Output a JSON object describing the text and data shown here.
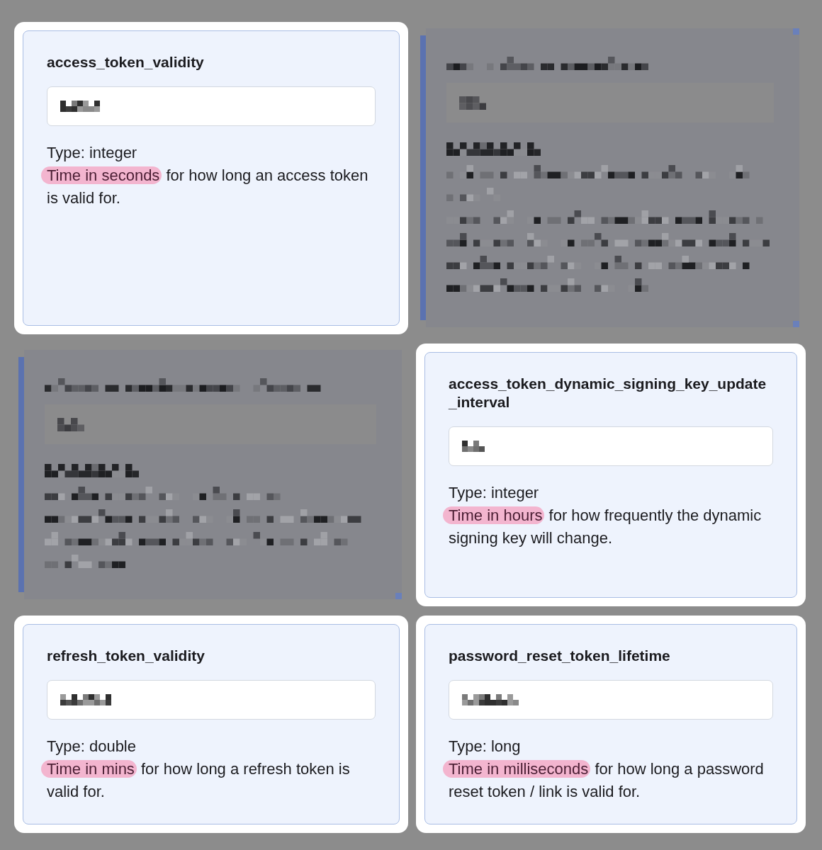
{
  "cards": [
    {
      "kind": "highlighted",
      "title": "access_token_validity",
      "field": {
        "pixelated": true
      },
      "type_line": "Type: integer",
      "description": [
        {
          "text": "Time in seconds",
          "highlighted": true
        },
        {
          "text": "for how long an access token is valid for.",
          "highlighted": false
        }
      ]
    },
    {
      "kind": "obscured"
    },
    {
      "kind": "obscured"
    },
    {
      "kind": "highlighted",
      "title": "access_token_dynamic_signing_key_update_interval",
      "field": {
        "pixelated": true
      },
      "type_line": "Type: integer",
      "description": [
        {
          "text": "Time in hours",
          "highlighted": true
        },
        {
          "text": "for how frequently the dynamic signing key will change.",
          "highlighted": false
        }
      ]
    },
    {
      "kind": "highlighted",
      "title": "refresh_token_validity",
      "field": {
        "pixelated": true
      },
      "type_line": "Type: double",
      "description": [
        {
          "text": "Time in mins",
          "highlighted": true
        },
        {
          "text": "for how long a refresh token is valid for.",
          "highlighted": false
        }
      ]
    },
    {
      "kind": "highlighted",
      "title": "password_reset_token_lifetime",
      "field": {
        "pixelated": true
      },
      "type_line": "Type: long",
      "description": [
        {
          "text": "Time in milliseconds",
          "highlighted": true
        },
        {
          "text": "for how long a password reset token / link is valid for.",
          "highlighted": false
        }
      ]
    }
  ]
}
